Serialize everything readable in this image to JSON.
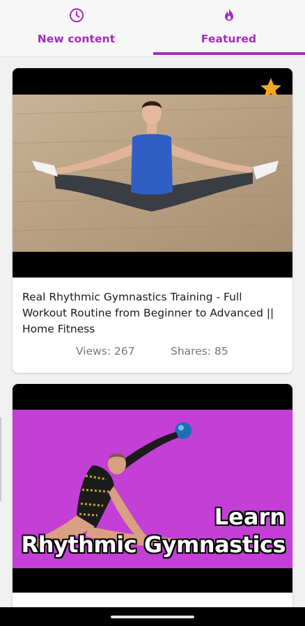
{
  "tabs": {
    "new_content": {
      "label": "New content",
      "icon": "clock-icon"
    },
    "featured": {
      "label": "Featured",
      "icon": "flame-icon",
      "selected": true
    }
  },
  "accent_color": "#a52bc2",
  "feed": [
    {
      "title": "Real Rhythmic Gymnastics Training - Full Workout Routine from Beginner to Advanced || Home Fitness",
      "views": "Views: 267",
      "shares": "Shares: 85",
      "featured_badge": "star-icon"
    },
    {
      "thumbnail_text_line1": "Learn",
      "thumbnail_text_line2": "Rhythmic Gymnastics"
    }
  ]
}
